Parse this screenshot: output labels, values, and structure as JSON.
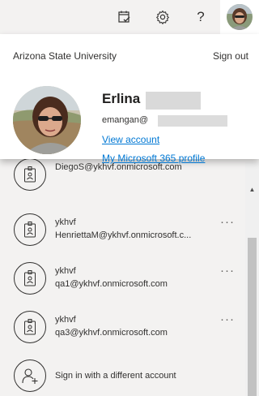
{
  "header": {
    "icons": [
      "calendar-check-icon",
      "gear-icon",
      "help-icon"
    ],
    "help_glyph": "?"
  },
  "me_card": {
    "organization": "Arizona State University",
    "sign_out": "Sign out",
    "first_name": "Erlina",
    "email_prefix": "emangan@",
    "view_account": "View account",
    "m365_profile": "My Microsoft 365 profile"
  },
  "accounts": [
    {
      "line1": "",
      "line2": "DiegoS@ykhvf.onmicrosoft.com",
      "more": "···"
    },
    {
      "line1": "ykhvf",
      "line2": "HenriettaM@ykhvf.onmicrosoft.c...",
      "more": "···"
    },
    {
      "line1": "ykhvf",
      "line2": "qa1@ykhvf.onmicrosoft.com",
      "more": "···"
    },
    {
      "line1": "ykhvf",
      "line2": "qa3@ykhvf.onmicrosoft.com",
      "more": "···"
    }
  ],
  "add_account": {
    "label": "Sign in with a different account",
    "icon": "add-person-icon"
  },
  "colors": {
    "link": "#0078d4",
    "background": "#f3f2f1",
    "card": "#ffffff"
  }
}
